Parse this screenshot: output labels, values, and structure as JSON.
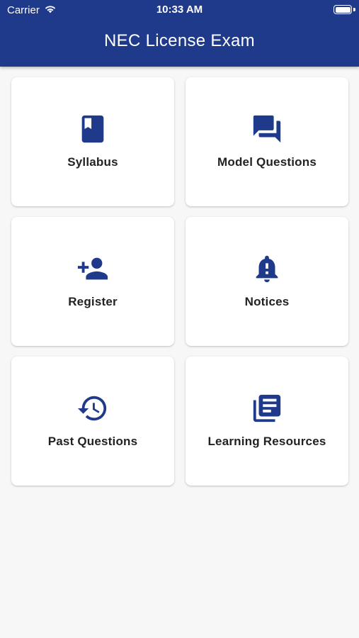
{
  "status_bar": {
    "carrier": "Carrier",
    "time": "10:33 AM",
    "icons": [
      "wifi-icon",
      "battery-icon"
    ]
  },
  "header": {
    "title": "NEC License Exam"
  },
  "colors": {
    "primary": "#1f3a8b",
    "background": "#f7f7f7",
    "card": "#ffffff",
    "label": "#222222"
  },
  "menu": {
    "items": [
      {
        "label": "Syllabus",
        "icon": "book-icon"
      },
      {
        "label": "Model Questions",
        "icon": "chat-bubbles-icon"
      },
      {
        "label": "Register",
        "icon": "add-person-icon"
      },
      {
        "label": "Notices",
        "icon": "bell-alert-icon"
      },
      {
        "label": "Past Questions",
        "icon": "history-clock-icon"
      },
      {
        "label": "Learning Resources",
        "icon": "library-books-icon"
      }
    ]
  }
}
